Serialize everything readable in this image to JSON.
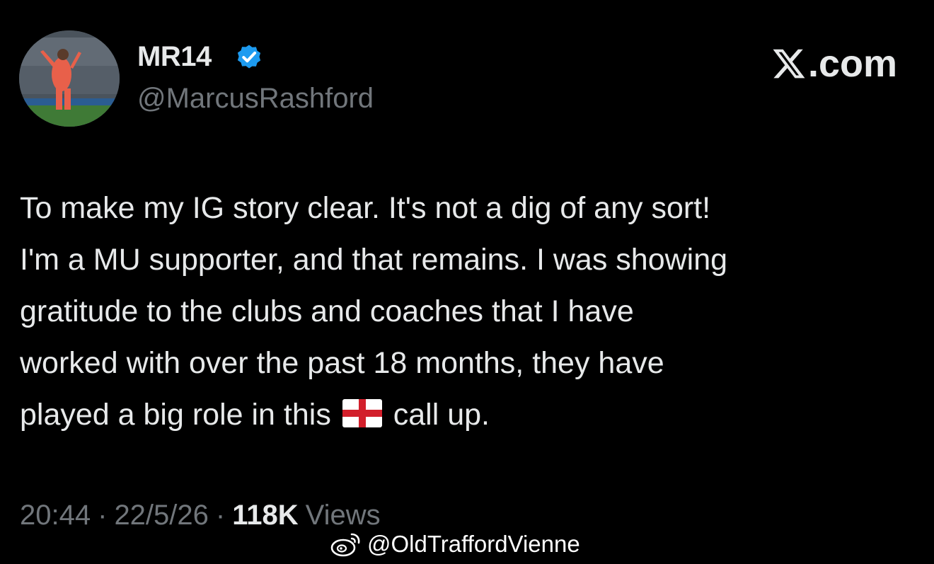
{
  "user": {
    "display_name": "MR14",
    "handle": "@MarcusRashford",
    "verified_icon": "verified-badge-icon",
    "avatar": "avatar-photo"
  },
  "brand": {
    "text": ".com",
    "icon": "x-logo-icon"
  },
  "tweet": {
    "lines": [
      "To make my IG story clear. It's not a dig of any sort!",
      "I'm a MU supporter, and that remains. I was showing",
      "gratitude to the clubs and coaches that I have",
      "worked with over the past 18 months, they have"
    ],
    "last_line_before_emoji": "played a big role in this",
    "emoji": "england-flag-emoji",
    "last_line_after_emoji": "call up."
  },
  "meta": {
    "time": "20:44",
    "separator": "·",
    "date": "22/5/26",
    "views_count": "118K",
    "views_label": "Views"
  },
  "watermark": {
    "icon": "weibo-icon",
    "text": "@OldTraffordVienne"
  },
  "colors": {
    "background": "#000000",
    "primary_text": "#e7e9ea",
    "secondary_text": "#71767b",
    "verified_blue": "#1d9bf0"
  }
}
